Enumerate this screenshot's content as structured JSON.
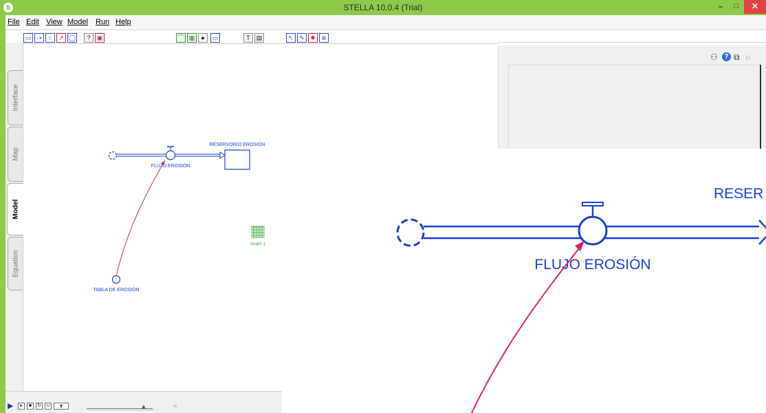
{
  "window": {
    "title": "STELLA 10.0.4 (Trial)",
    "logo_letter": "S",
    "controls": {
      "minimize": "–",
      "maximize": "□",
      "close": "✕"
    }
  },
  "menu": [
    {
      "label": "File"
    },
    {
      "label": "Edit"
    },
    {
      "label": "View"
    },
    {
      "label": "Model"
    },
    {
      "label": "Run"
    },
    {
      "label": "Help"
    }
  ],
  "toolbar": {
    "help_label": "?",
    "text_label": "T"
  },
  "side_tabs": [
    {
      "label": "Interface",
      "active": false
    },
    {
      "label": "Map",
      "active": false
    },
    {
      "label": "Model",
      "active": true
    },
    {
      "label": "Equation",
      "active": false
    }
  ],
  "model": {
    "flow_label": "FLUJO EROSIÓN",
    "stock_label": "RESERVORIO EROSIÓN",
    "converter_label": "TABLA DE EROSIÓN",
    "graph_label": "Graph 1"
  },
  "zoom": {
    "flow_label": "FLUJO EROSIÓN",
    "stock_label_partial": "RESER"
  },
  "colors": {
    "titlebar": "#8fc94a",
    "model_blue": "#1a3fd8",
    "connector_pink": "#e0206e",
    "graph_green": "#3a9a3a",
    "close_red": "#e04343"
  }
}
